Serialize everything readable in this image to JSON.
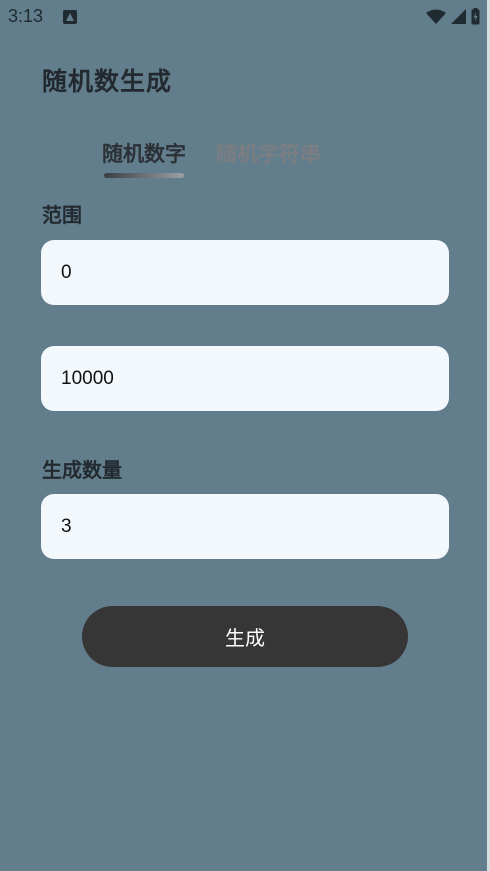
{
  "status_bar": {
    "time": "3:13",
    "notification_icon": "a-notification-icon",
    "wifi_icon": "wifi-icon",
    "signal_icon": "cell-signal-icon",
    "battery_icon": "battery-charging-icon"
  },
  "page": {
    "title": "随机数生成"
  },
  "tabs": [
    {
      "label": "随机数字",
      "active": true
    },
    {
      "label": "随机字符串",
      "active": false
    }
  ],
  "form": {
    "range_label": "范围",
    "min_value": "0",
    "max_value": "10000",
    "count_label": "生成数量",
    "count_value": "3"
  },
  "actions": {
    "generate_label": "生成"
  },
  "colors": {
    "background": "#627d8b",
    "field_background": "#f3f8fd",
    "button_background": "#363636",
    "button_text": "#ffffff",
    "active_tab": "#2b3136",
    "inactive_tab": "#7a7e82"
  }
}
